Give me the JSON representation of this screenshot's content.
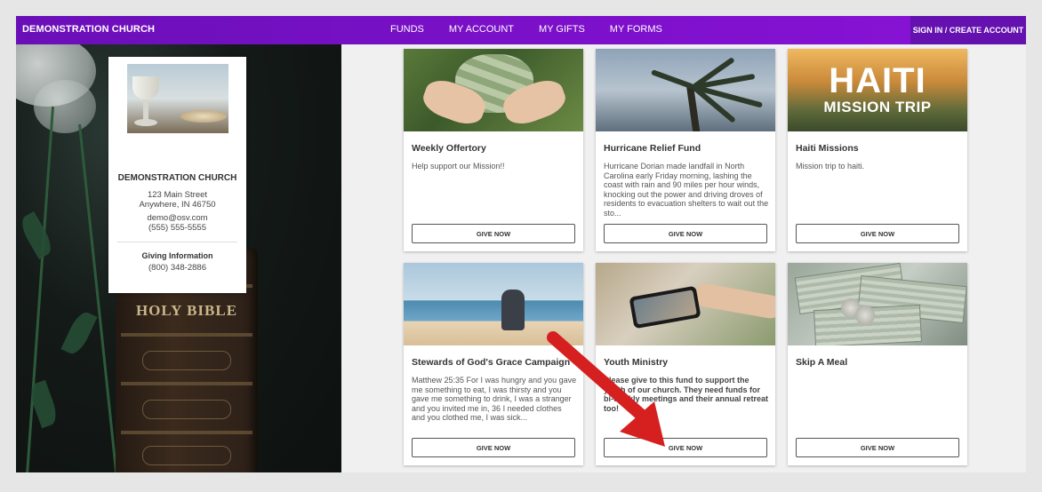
{
  "nav": {
    "brand": "DEMONSTRATION CHURCH",
    "links": [
      "FUNDS",
      "MY ACCOUNT",
      "MY GIFTS",
      "MY FORMS"
    ],
    "signin": "SIGN IN / CREATE ACCOUNT",
    "color": "#7b10c9"
  },
  "hero": {
    "book_title": "HOLY BIBLE"
  },
  "church": {
    "name": "DEMONSTRATION CHURCH",
    "address1": "123 Main Street",
    "address2": "Anywhere, IN 46750",
    "email": "demo@osv.com",
    "phone": "(555) 555-5555",
    "giving_label": "Giving Information",
    "giving_phone": "(800) 348-2886"
  },
  "funds": [
    {
      "title": "Weekly Offertory",
      "description": "Help support our Mission!!",
      "button": "GIVE NOW"
    },
    {
      "title": "Hurricane Relief Fund",
      "description": "Hurricane Dorian made landfall in North Carolina early Friday morning, lashing the coast with rain and 90 miles per hour winds, knocking out the power and driving droves of residents to evacuation shelters to wait out the sto...",
      "button": "GIVE NOW"
    },
    {
      "title": "Haiti Missions",
      "description": "Mission trip to haiti.",
      "button": "GIVE NOW",
      "image_text_big": "HAITI",
      "image_text_small": "MISSION TRIP"
    },
    {
      "title": "Stewards of God's Grace Campaign",
      "description": "Matthew 25:35 For I was hungry and you gave me something to eat, I was thirsty and you gave me something to drink, I was a stranger and you invited me in, 36 I needed clothes and you clothed me, I was sick...",
      "button": "GIVE NOW"
    },
    {
      "title": "Youth Ministry",
      "description": "Please give to this fund to support the youth of our church. They need funds for bi-weekly meetings and their annual retreat too!",
      "button": "GIVE NOW"
    },
    {
      "title": "Skip A Meal",
      "description": "",
      "button": "GIVE NOW"
    }
  ],
  "annotation": {
    "arrow_color": "#d62020"
  }
}
